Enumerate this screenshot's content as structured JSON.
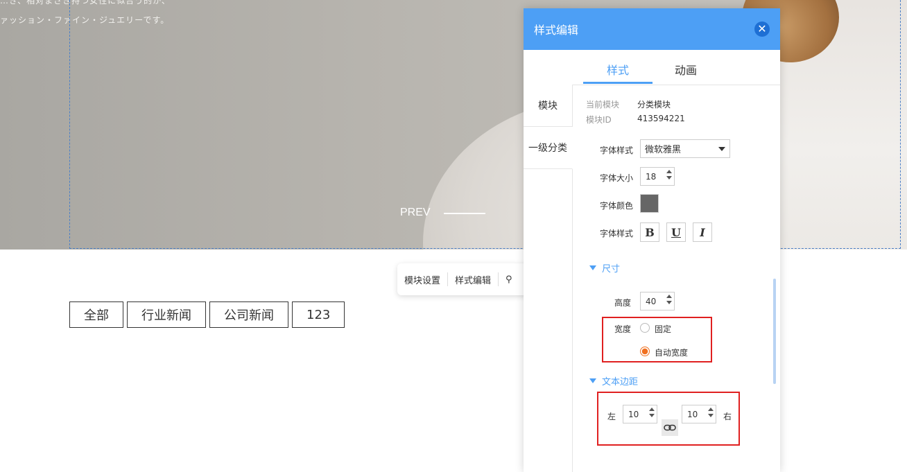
{
  "hero": {
    "text_line1": "…き、相对まさき持つ女性に似合う的か、",
    "text_line2": "ァッション・ファイン・ジュエリーです。",
    "prev_label": "PREV"
  },
  "toolbar": {
    "module_settings": "模块设置",
    "style_edit": "样式编辑",
    "more_icon_glyph": "⚲"
  },
  "categories": [
    "全部",
    "行业新闻",
    "公司新闻",
    "123"
  ],
  "panel": {
    "title": "样式编辑",
    "close_glyph": "✕",
    "tabs": [
      "样式",
      "动画"
    ],
    "side_items": [
      "模块",
      "一级分类"
    ],
    "current_module_label": "当前模块",
    "current_module_value": "分类模块",
    "module_id_label": "模块ID",
    "module_id_value": "413594221",
    "font_family_label": "字体样式",
    "font_family_value": "微软雅黑",
    "font_size_label": "字体大小",
    "font_size_value": "18",
    "font_color_label": "字体颜色",
    "font_color": "#666666",
    "font_style_label": "字体样式",
    "bold": "B",
    "underline": "U",
    "italic": "I",
    "size_section": "尺寸",
    "height_label": "高度",
    "height_value": "40",
    "width_label": "宽度",
    "width_fixed": "固定",
    "width_auto": "自动宽度",
    "padding_section": "文本边距",
    "left_label": "左",
    "left_value": "10",
    "right_label": "右",
    "right_value": "10"
  },
  "colors": {
    "accent": "#4d9ff5",
    "radio_on": "#f07020",
    "highlight": "#e02020"
  }
}
